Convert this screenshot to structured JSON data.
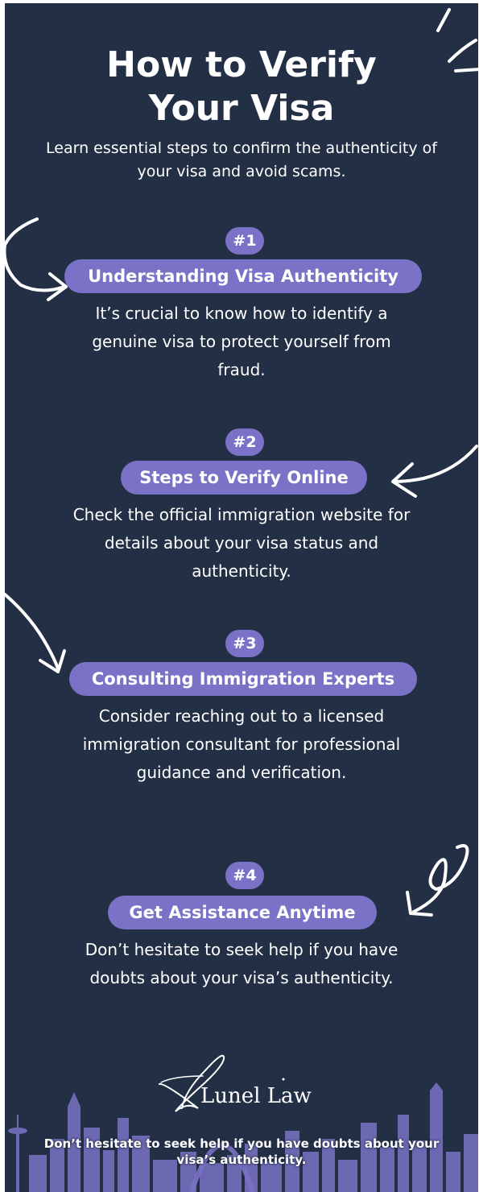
{
  "header": {
    "title_line1": "How to Verify",
    "title_line2": "Your Visa",
    "subtitle": "Learn essential steps to confirm the authenticity of your visa and avoid scams."
  },
  "steps": [
    {
      "number": "#1",
      "heading": "Understanding Visa Authenticity",
      "description": "It’s crucial to know how to identify a genuine visa to protect yourself from fraud."
    },
    {
      "number": "#2",
      "heading": "Steps to Verify Online",
      "description": "Check the official immigration website for details about your visa status and authenticity."
    },
    {
      "number": "#3",
      "heading": "Consulting Immigration Experts",
      "description": "Consider reaching out to a licensed immigration consultant for professional guidance and verification."
    },
    {
      "number": "#4",
      "heading": "Get Assistance Anytime",
      "description": "Don’t hesitate to seek help if you have doubts about your visa’s authenticity."
    }
  ],
  "brand": {
    "name": "Lunel Law",
    "logo_icon": "script-l-monogram-icon"
  },
  "footer": {
    "text": "Don’t hesitate to seek help if you have doubts about your visa’s authenticity."
  },
  "colors": {
    "background": "#232f45",
    "accent": "#7a72c6",
    "text": "#ffffff",
    "skyline": "#7a72c6"
  }
}
